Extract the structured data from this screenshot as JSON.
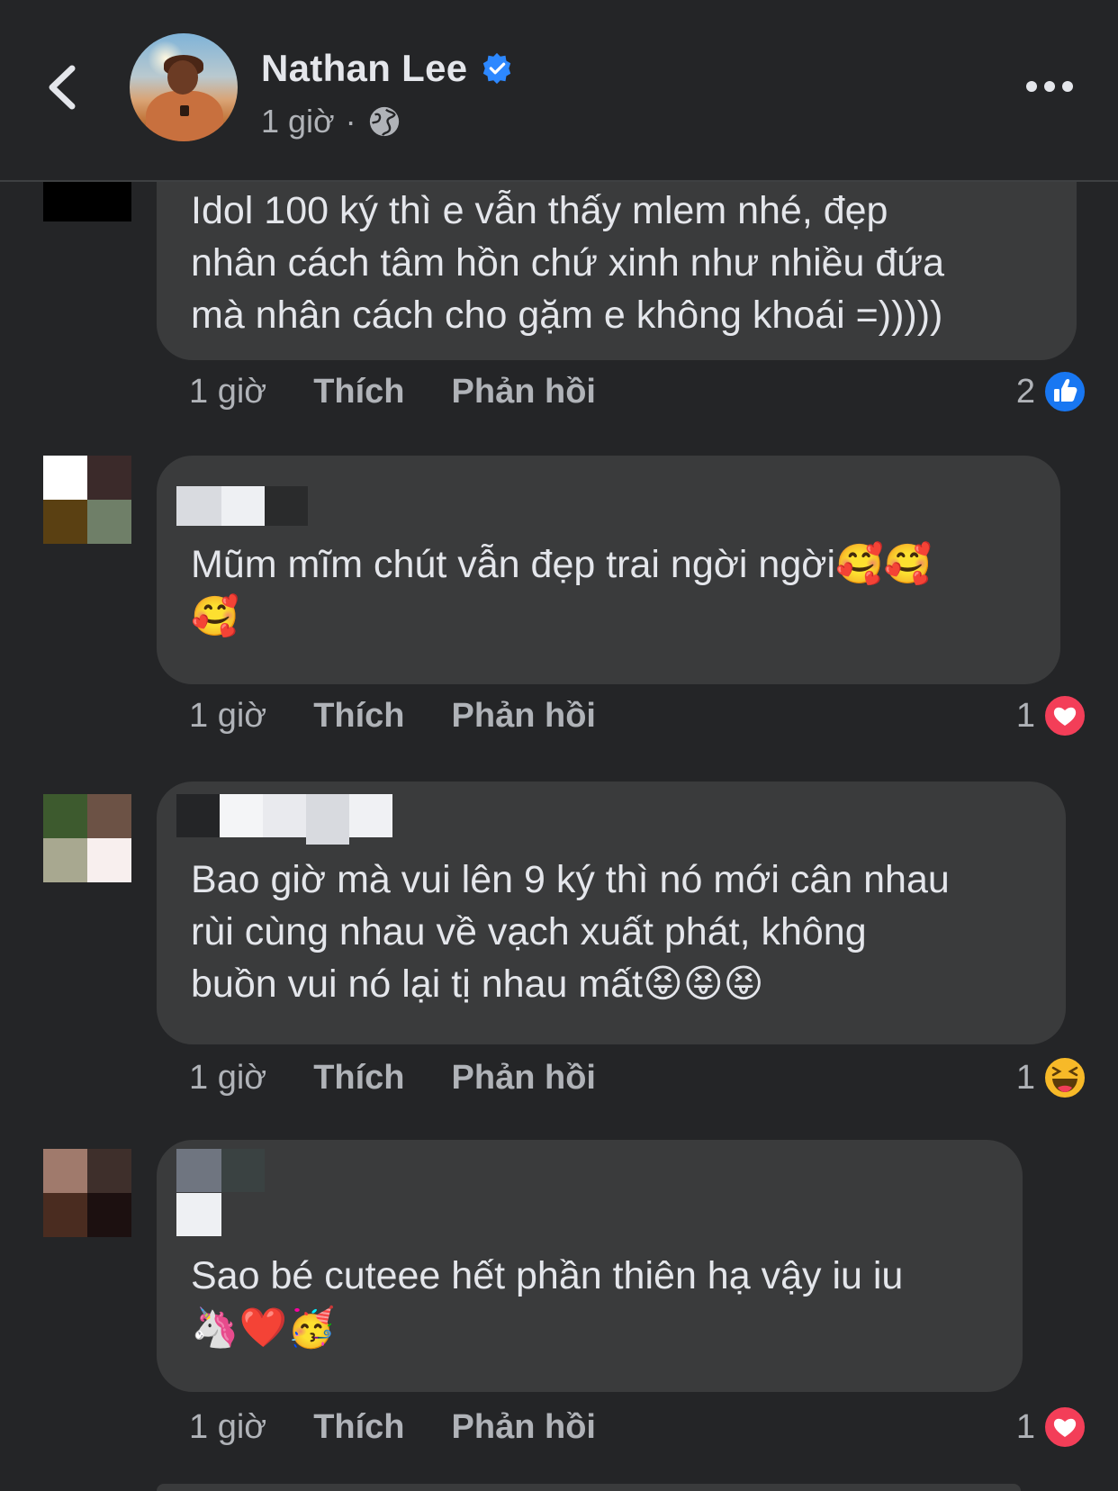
{
  "header": {
    "user_name": "Nathan Lee",
    "time": "1 giờ",
    "separator": "·"
  },
  "comments": [
    {
      "text": "Idol 100 ký thì e vẫn thấy mlem nhé, đẹp\nnhân cách tâm hồn chứ xinh như nhiều đứa\nmà nhân cách cho gặm e không khoái =)))))",
      "time": "1 giờ",
      "like_label": "Thích",
      "reply_label": "Phản hồi",
      "reaction_count": "2",
      "reaction": "like-icon"
    },
    {
      "text": "Mũm mĩm chút vẫn đẹp trai ngời ngời🥰🥰\n🥰",
      "time": "1 giờ",
      "like_label": "Thích",
      "reply_label": "Phản hồi",
      "reaction_count": "1",
      "reaction": "love-icon"
    },
    {
      "text": "Bao giờ mà vui lên 9 ký thì nó mới cân nhau\nrùi cùng nhau về vạch xuất phát, không\nbuồn vui nó lại tị nhau mất😝😝😝",
      "time": "1 giờ",
      "like_label": "Thích",
      "reply_label": "Phản hồi",
      "reaction_count": "1",
      "reaction": "haha-icon"
    },
    {
      "text": "Sao bé cuteee hết phần thiên hạ vậy iu iu\n🦄❤️🥳",
      "time": "1 giờ",
      "like_label": "Thích",
      "reply_label": "Phản hồi",
      "reaction_count": "1",
      "reaction": "love-icon"
    }
  ],
  "colors": {
    "background": "#242527",
    "bubble": "#3a3b3c",
    "text": "#e4e6eb",
    "muted": "#b0b3b8",
    "like_blue": "#1877f2",
    "love_red": "#f33e58",
    "haha_yellow": "#f7b928"
  }
}
